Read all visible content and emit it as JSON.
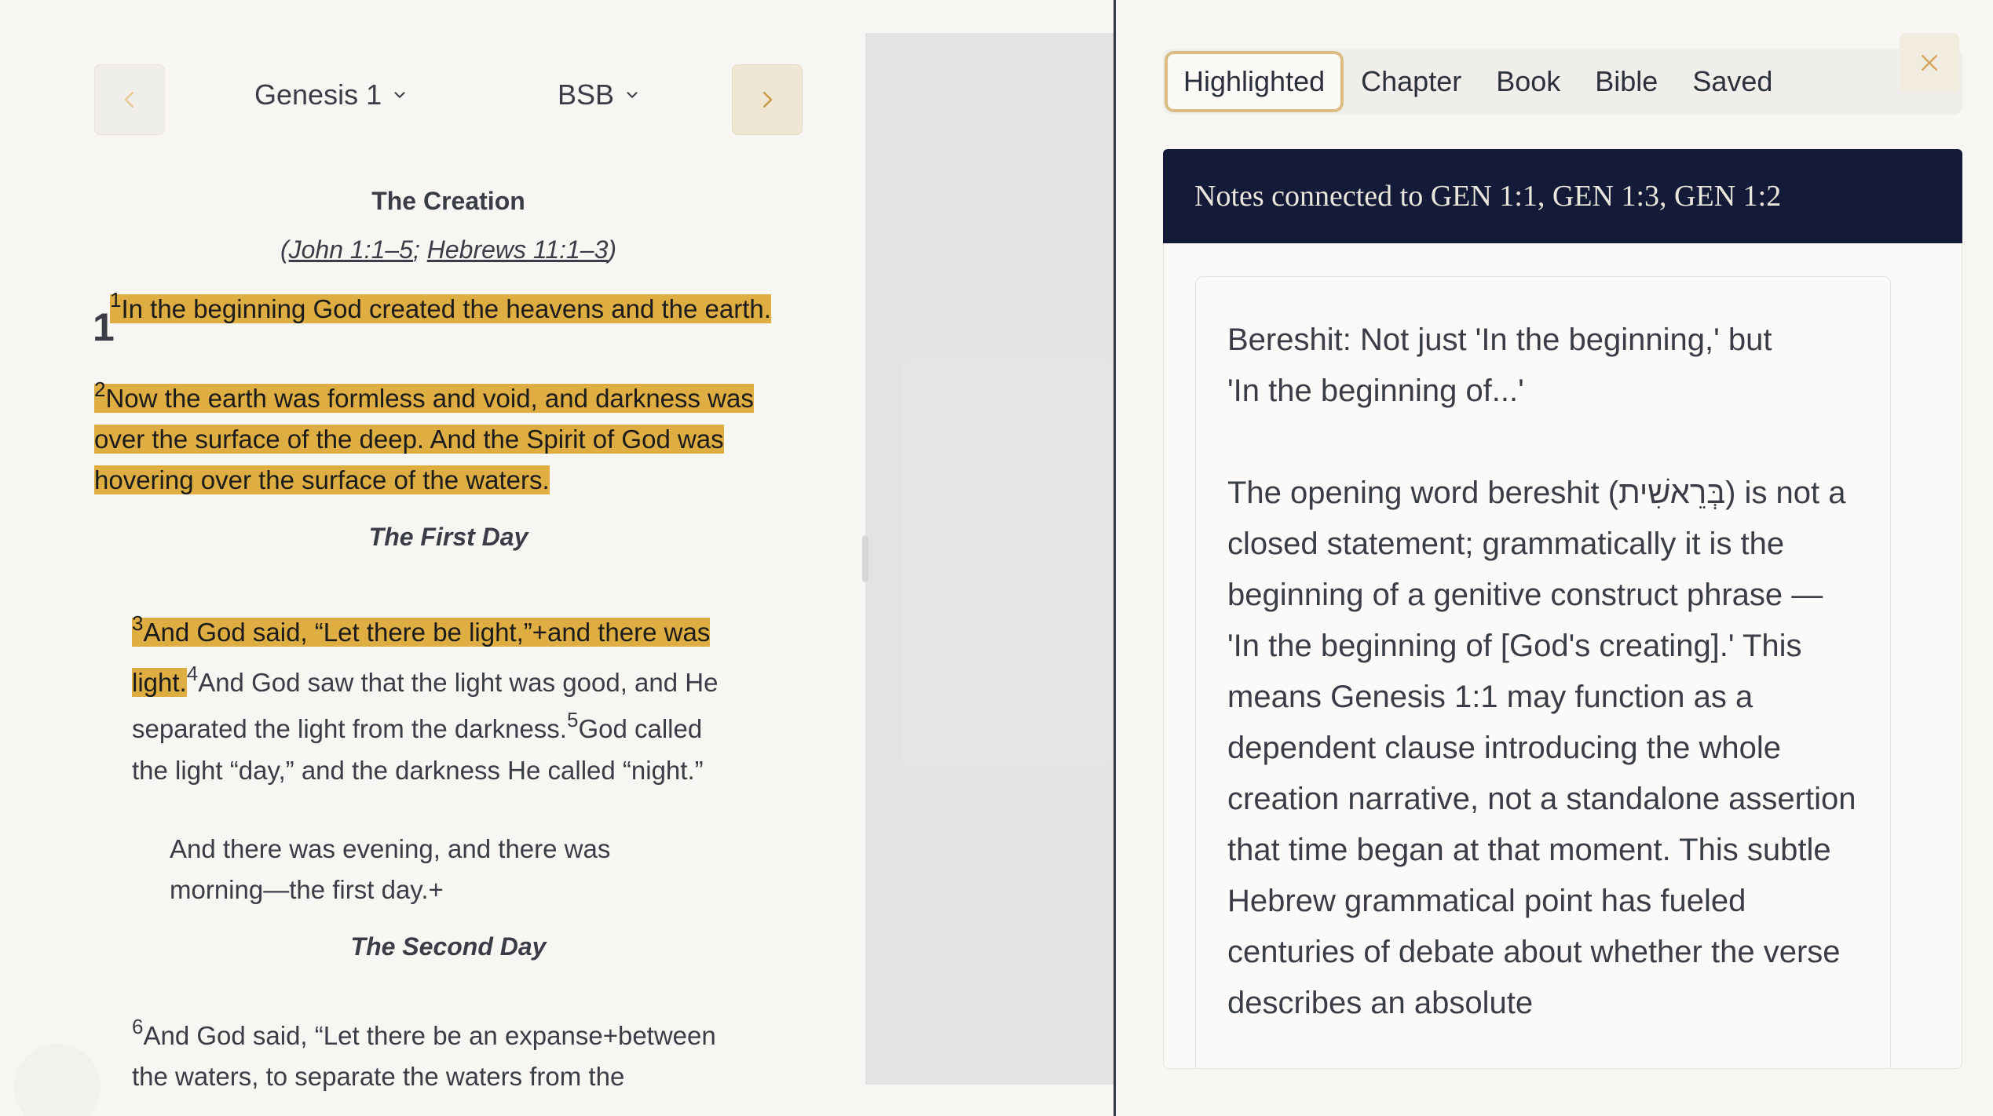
{
  "reader": {
    "book_selector": "Genesis 1",
    "version_selector": "BSB",
    "chapter_number": "1",
    "heading_creation": "The Creation",
    "crossref_open": "(",
    "crossref_1": "John 1:1–5",
    "crossref_sep": ";",
    "crossref_2": "Hebrews 11:1–3",
    "crossref_close": ")",
    "verses": {
      "v1_num": "1",
      "v1": "In the beginning God created the heavens and the earth.",
      "v2_num": "2",
      "v2_line1": "Now the earth was formless and void, and darkness was",
      "v2_line2": "over the surface of the deep. And the Spirit of God was",
      "v2_line3": "hovering over the surface of the waters.",
      "v3_num": "3",
      "v3_line1": "And God said, “Let there be light,”+and there was",
      "v3_line2": "light.",
      "v4_num": "4",
      "v4_line1": "And God saw that the light was good, and He",
      "v4_line2": "separated the light from the darkness.",
      "v5_num": "5",
      "v5_line1": "God called",
      "v5_line2": "the light “day,” and the darkness He called “night.”",
      "v5_poetry1": "And there was evening, and there was",
      "v5_poetry2": "morning—the first day.+",
      "v6_num": "6",
      "v6_line1": "And God said, “Let there be an expanse+between",
      "v6_line2": "the waters, to separate the waters from the"
    },
    "heading_first_day": "The First Day",
    "heading_second_day": "The Second Day"
  },
  "notes": {
    "tabs": [
      "Highlighted",
      "Chapter",
      "Book",
      "Bible",
      "Saved"
    ],
    "active_tab": "Highlighted",
    "header": "Notes connected to GEN 1:1, GEN 1:3, GEN 1:2",
    "note_title_line1": "Bereshit: Not just 'In the beginning,' but",
    "note_title_line2": "'In the beginning of...'",
    "note_body": "The opening word bereshit (בְּרֵאשִׁית) is not a closed statement; grammatically it is the beginning of a genitive construct phrase — 'In the beginning of [God's creating].' This means Genesis 1:1 may function as a dependent clause introducing the whole creation narrative, not a standalone assertion that time began at that moment. This subtle Hebrew grammatical point has fueled centuries of debate about whether the verse describes an absolute"
  },
  "colors": {
    "highlight": "#dfae42",
    "header_bg": "#141b38",
    "accent": "#d9bd86"
  },
  "icons": {
    "prev": "chevron-left-icon",
    "next": "chevron-right-icon",
    "dropdown": "chevron-down-icon",
    "close": "close-icon"
  }
}
